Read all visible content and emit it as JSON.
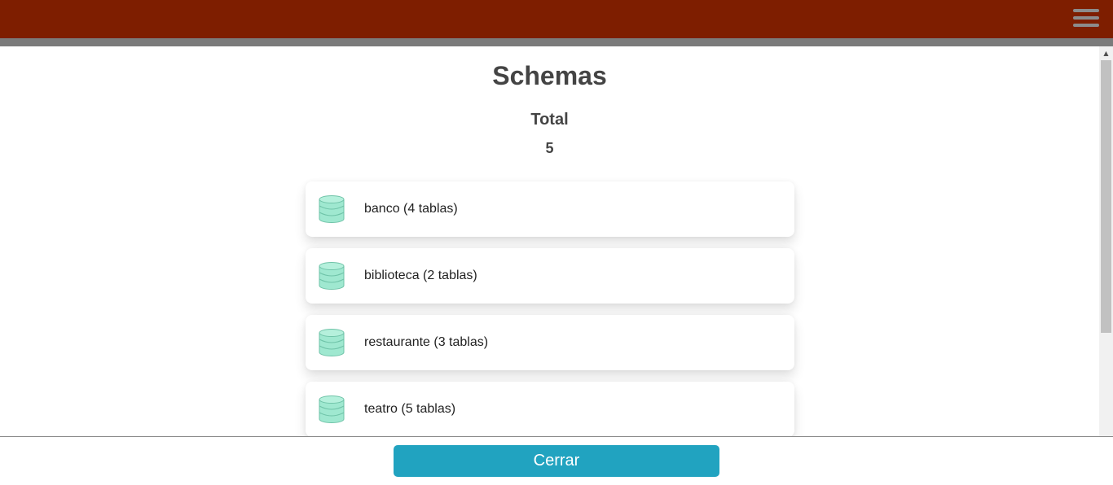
{
  "header": {
    "menu_icon": "hamburger-menu-icon",
    "bar_color": "#7e1e00",
    "strip_color": "#7b7b7b"
  },
  "page": {
    "title": "Schemas",
    "total_label": "Total",
    "total_value": "5"
  },
  "schemas": [
    {
      "label": "banco (4 tablas)",
      "icon": "database-icon"
    },
    {
      "label": "biblioteca (2 tablas)",
      "icon": "database-icon"
    },
    {
      "label": "restaurante (3 tablas)",
      "icon": "database-icon"
    },
    {
      "label": "teatro (5 tablas)",
      "icon": "database-icon"
    }
  ],
  "footer": {
    "close_label": "Cerrar",
    "button_color": "#21a3c0"
  },
  "colors": {
    "icon_fill": "#9fe8d0",
    "icon_stroke": "#6fc3a8"
  }
}
